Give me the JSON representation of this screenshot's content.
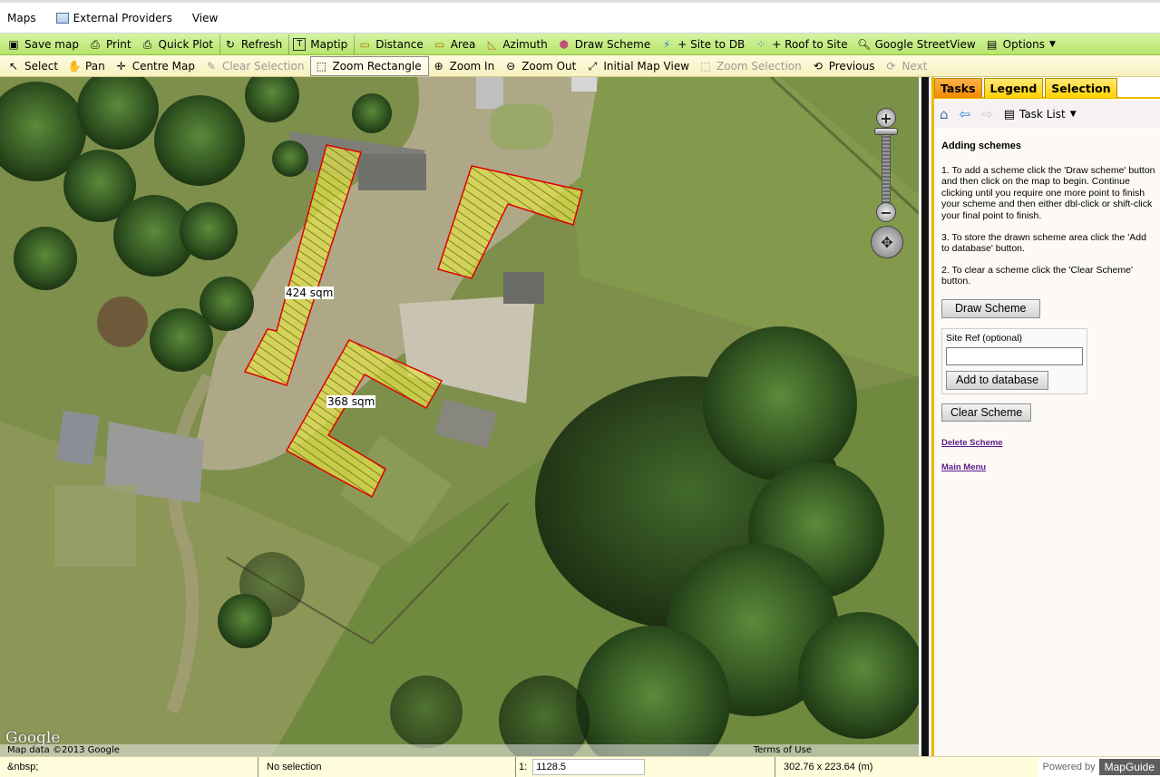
{
  "menubar": {
    "items": [
      {
        "label": "Maps"
      },
      {
        "label": "External Providers"
      },
      {
        "label": "View"
      }
    ]
  },
  "toolbar1": {
    "save_map": "Save map",
    "print": "Print",
    "quick_plot": "Quick Plot",
    "refresh": "Refresh",
    "maptip": "Maptip",
    "distance": "Distance",
    "area": "Area",
    "azimuth": "Azimuth",
    "draw_scheme": "Draw Scheme",
    "site_to_db": "+ Site to DB",
    "roof_to_site": "+ Roof to Site",
    "streetview": "Google StreetView",
    "options": "Options"
  },
  "toolbar2": {
    "select": "Select",
    "pan": "Pan",
    "centre_map": "Centre Map",
    "clear_selection": "Clear Selection",
    "zoom_rectangle": "Zoom Rectangle",
    "zoom_in": "Zoom In",
    "zoom_out": "Zoom Out",
    "initial_map_view": "Initial Map View",
    "zoom_selection": "Zoom Selection",
    "previous": "Previous",
    "next": "Next"
  },
  "map": {
    "area_labels": [
      "424 sqm",
      "368 sqm"
    ],
    "attribution": "Map data ©2013 Google",
    "terms": "Terms of Use",
    "logo_text": "Google",
    "colors": {
      "scheme_fill": "#e6e64a",
      "scheme_stroke": "#e00000"
    }
  },
  "panel": {
    "tabs": [
      "Tasks",
      "Legend",
      "Selection"
    ],
    "task_list_label": "Task List",
    "heading": "Adding schemes",
    "instructions": [
      "1. To add a scheme click the 'Draw scheme' button and then click on the map to begin. Continue clicking until you require one more point to finish your scheme and then either dbl-click or shift-click your final point to finish.",
      "3. To store the drawn scheme area click the 'Add to database' button.",
      "2. To clear a scheme click the 'Clear Scheme' button."
    ],
    "draw_scheme_button": "Draw Scheme",
    "site_ref_label": "Site Ref (optional)",
    "site_ref_value": "",
    "add_to_db_button": "Add to database",
    "clear_scheme_button": "Clear Scheme",
    "delete_scheme_link": "Delete Scheme",
    "main_menu_link": "Main Menu",
    "accent_color": "#f0b800"
  },
  "statusbar": {
    "coords": "&nbsp;",
    "selection": "No selection",
    "scale_prefix": "1:",
    "scale_value": "1128.5",
    "extent": "302.76 x 223.64 (m)",
    "powered_by": "Powered by",
    "brand": "MapGuide"
  }
}
